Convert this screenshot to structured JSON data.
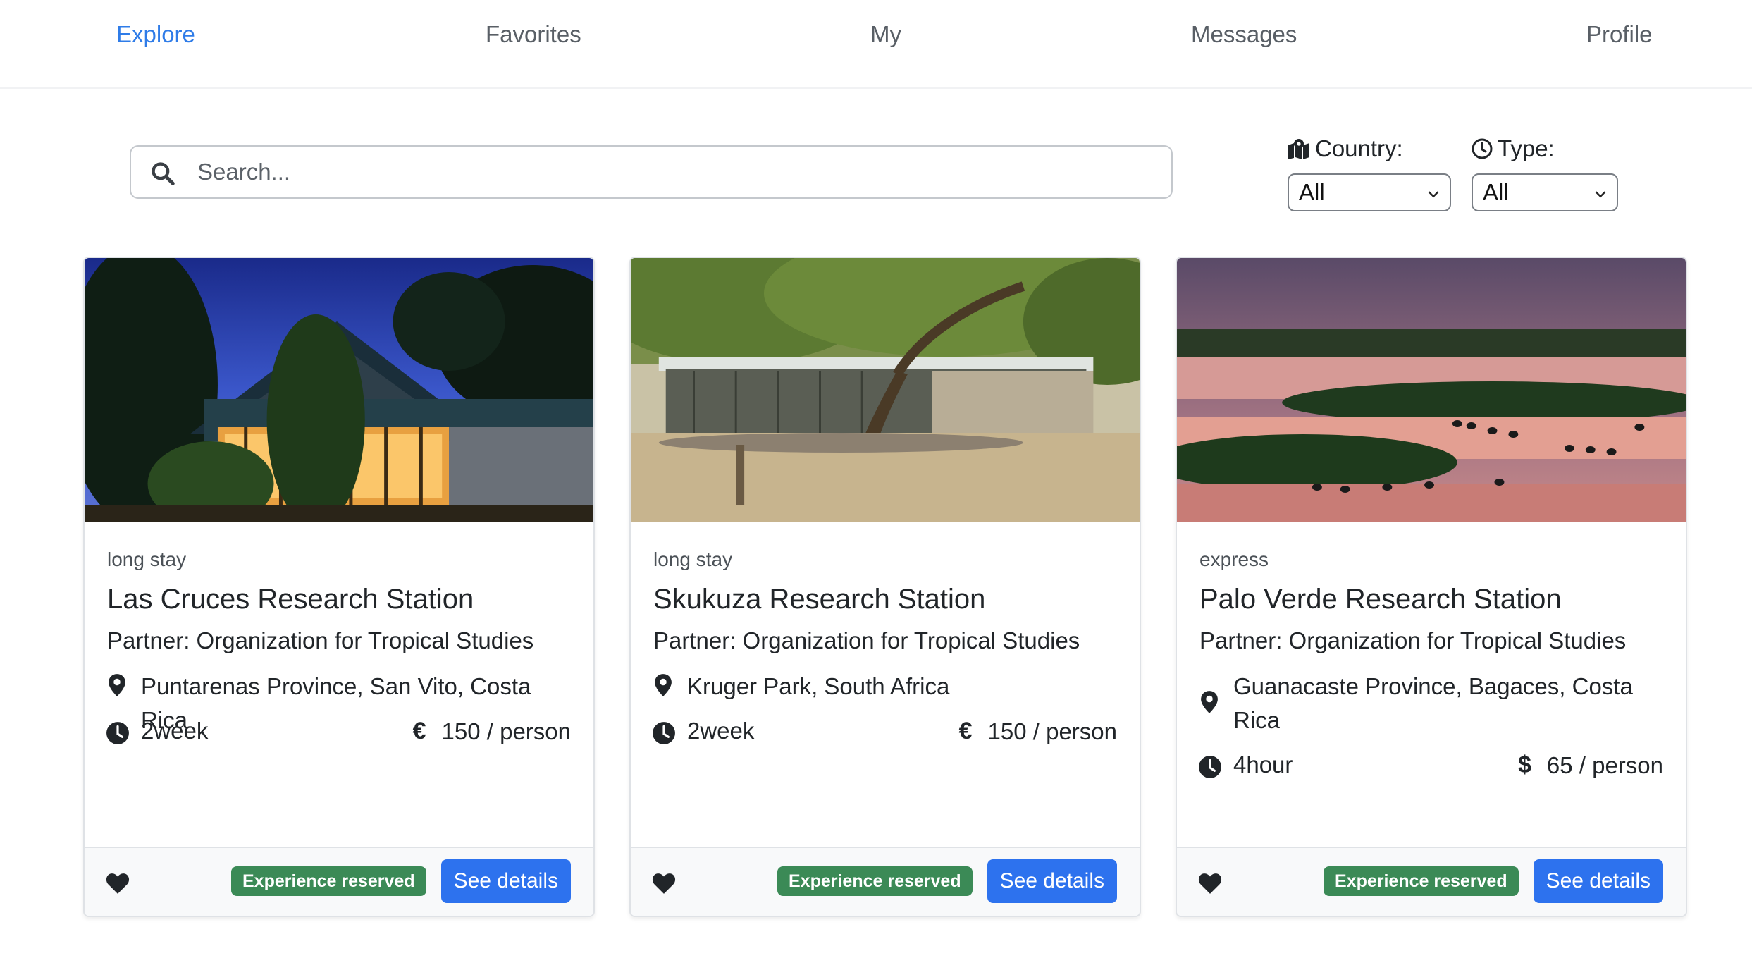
{
  "nav": {
    "items": [
      {
        "label": "Explore",
        "active": true
      },
      {
        "label": "Favorites",
        "active": false
      },
      {
        "label": "My",
        "active": false
      },
      {
        "label": "Messages",
        "active": false
      },
      {
        "label": "Profile",
        "active": false
      }
    ]
  },
  "search": {
    "placeholder": "Search...",
    "value": ""
  },
  "filters": {
    "country": {
      "label": "Country:",
      "icon": "map-location-icon",
      "selected": "All"
    },
    "type": {
      "label": "Type:",
      "icon": "clock-icon",
      "selected": "All"
    }
  },
  "cards": [
    {
      "type": "long stay",
      "title": "Las Cruces Research Station",
      "partner": "Partner: Organization for Tropical Studies",
      "location": "Puntarenas Province, San Vito, Costa Rica",
      "duration": "2week",
      "currency": "€",
      "price": "150 / person",
      "badge": "Experience reserved",
      "button": "See details"
    },
    {
      "type": "long stay",
      "title": "Skukuza Research Station",
      "partner": "Partner: Organization for Tropical Studies",
      "location": "Kruger Park, South Africa",
      "duration": "2week",
      "currency": "€",
      "price": "150 / person",
      "badge": "Experience reserved",
      "button": "See details"
    },
    {
      "type": "express",
      "title": "Palo Verde Research Station",
      "partner": "Partner: Organization for Tropical Studies",
      "location": "Guanacaste Province, Bagaces, Costa Rica",
      "duration": "4hour",
      "currency": "$",
      "price": "65 / person",
      "badge": "Experience reserved",
      "button": "See details"
    }
  ],
  "colors": {
    "accent": "#2f7ce8",
    "button": "#2d72ee",
    "badge": "#3b8a56"
  }
}
